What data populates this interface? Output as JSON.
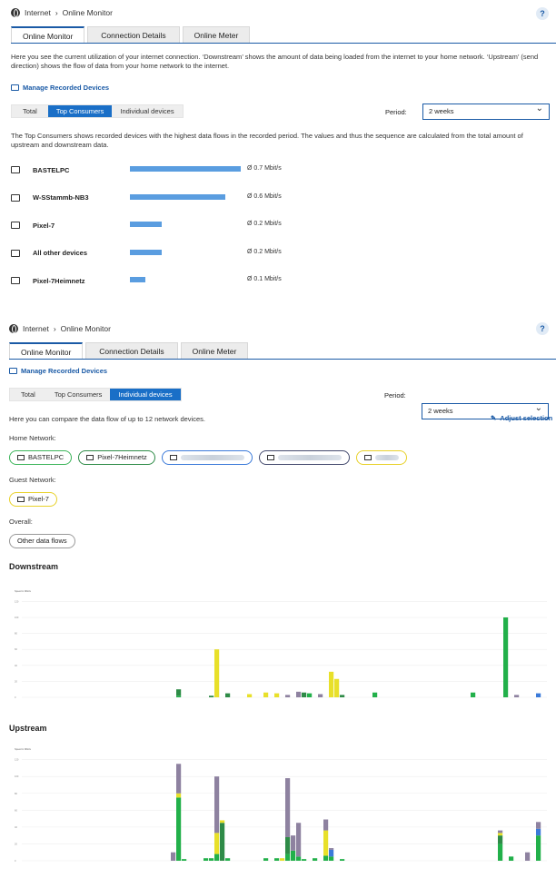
{
  "top": {
    "breadcrumb": [
      "Internet",
      "Online Monitor"
    ],
    "help": "?",
    "tabs": [
      "Online Monitor",
      "Connection Details",
      "Online Meter"
    ],
    "intro": "Here you see the current utilization of your internet connection. ‘Downstream’ shows the amount of data being loaded from the internet to your home network. ‘Upstream’ (send direction) shows the flow of data from your home network to the internet.",
    "manage_link": "Manage Recorded Devices",
    "segments": [
      "Total",
      "Top Consumers",
      "Individual devices"
    ],
    "period_label": "Period:",
    "period_value": "2 weeks",
    "desc": "The Top Consumers shows recorded devices with the highest data flows in the recorded period. The values and thus the sequence are calculated from the total amount of upstream and downstream data.",
    "devices": [
      {
        "name": "BASTELPC",
        "rate": "Ø 0.7 Mbit/s",
        "share": 1.0,
        "icon": "laptop-icon"
      },
      {
        "name": "W-SStammb-NB3",
        "rate": "Ø 0.6 Mbit/s",
        "share": 0.86,
        "icon": "laptop-icon"
      },
      {
        "name": "Pixel-7",
        "rate": "Ø 0.2 Mbit/s",
        "share": 0.29,
        "icon": "phone-icon"
      },
      {
        "name": "All other devices",
        "rate": "Ø 0.2 Mbit/s",
        "share": 0.29,
        "icon": "devices-icon"
      },
      {
        "name": "Pixel-7Heimnetz",
        "rate": "Ø 0.1 Mbit/s",
        "share": 0.14,
        "icon": "phone-laptop-icon"
      }
    ]
  },
  "bottom": {
    "breadcrumb": [
      "Internet",
      "Online Monitor"
    ],
    "help": "?",
    "tabs": [
      "Online Monitor",
      "Connection Details",
      "Online Meter"
    ],
    "manage_link": "Manage Recorded Devices",
    "segments": [
      "Total",
      "Top Consumers",
      "Individual devices"
    ],
    "period_label": "Period:",
    "period_value": "2 weeks",
    "compare_text": "Here you can compare the data flow of up to 12 network devices.",
    "adjust_link": "Adjust selection",
    "home_network_label": "Home Network:",
    "home_chips": [
      {
        "name": "BASTELPC",
        "color": "#3cb55a"
      },
      {
        "name": "Pixel-7Heimnetz",
        "color": "#2e8b47"
      },
      {
        "name": "",
        "color": "#3b7ad9"
      },
      {
        "name": "",
        "color": "#444a6e"
      },
      {
        "name": "",
        "color": "#e8d12a"
      }
    ],
    "guest_network_label": "Guest Network:",
    "guest_chips": [
      {
        "name": "Pixel-7",
        "color": "#e8d12a"
      }
    ],
    "overall_label": "Overall:",
    "overall_chips": [
      {
        "name": "Other data flows",
        "color": "#999999"
      }
    ],
    "downstream_title": "Downstream",
    "upstream_title": "Upstream"
  },
  "chart_data": [
    {
      "type": "bar",
      "title": "Downstream",
      "ylabel": "Speed in Mbit/s",
      "ylim": [
        0,
        125
      ],
      "yticks": [
        0,
        20,
        40,
        60,
        80,
        100,
        120
      ],
      "series_colors": {
        "green": "#22b04a",
        "darkgreen": "#2e8b47",
        "yellow": "#e8e02a",
        "purple": "#8e82a0",
        "blue": "#3b7ad9"
      },
      "bars": [
        {
          "i": 28,
          "green": 2,
          "darkgreen": 8
        },
        {
          "i": 34,
          "darkgreen": 2
        },
        {
          "i": 35,
          "yellow": 60
        },
        {
          "i": 37,
          "darkgreen": 5
        },
        {
          "i": 41,
          "yellow": 4
        },
        {
          "i": 44,
          "yellow": 6
        },
        {
          "i": 46,
          "yellow": 5
        },
        {
          "i": 48,
          "purple": 3
        },
        {
          "i": 50,
          "purple": 7
        },
        {
          "i": 51,
          "darkgreen": 6
        },
        {
          "i": 52,
          "green": 5
        },
        {
          "i": 54,
          "purple": 4
        },
        {
          "i": 56,
          "yellow": 32
        },
        {
          "i": 57,
          "yellow": 23
        },
        {
          "i": 58,
          "darkgreen": 3
        },
        {
          "i": 64,
          "green": 6
        },
        {
          "i": 82,
          "green": 6
        },
        {
          "i": 88,
          "green": 100
        },
        {
          "i": 90,
          "purple": 3
        },
        {
          "i": 94,
          "blue": 5
        }
      ]
    },
    {
      "type": "bar",
      "title": "Upstream",
      "ylabel": "Speed in Mbit/s",
      "ylim": [
        0,
        125
      ],
      "yticks": [
        0,
        20,
        40,
        60,
        80,
        100,
        120
      ],
      "bars": [
        {
          "i": 27,
          "purple": 10
        },
        {
          "i": 28,
          "green": 75,
          "yellow": 5,
          "purple": 35
        },
        {
          "i": 29,
          "green": 2
        },
        {
          "i": 33,
          "green": 3
        },
        {
          "i": 34,
          "green": 3
        },
        {
          "i": 35,
          "green": 8,
          "yellow": 25,
          "purple": 67
        },
        {
          "i": 36,
          "darkgreen": 45,
          "yellow": 3
        },
        {
          "i": 37,
          "green": 3
        },
        {
          "i": 44,
          "green": 3
        },
        {
          "i": 46,
          "green": 3
        },
        {
          "i": 47,
          "yellow": 3
        },
        {
          "i": 48,
          "green": 8,
          "darkgreen": 20,
          "purple": 70
        },
        {
          "i": 49,
          "green": 12,
          "purple": 18
        },
        {
          "i": 50,
          "green": 5,
          "purple": 40
        },
        {
          "i": 51,
          "green": 2
        },
        {
          "i": 53,
          "green": 3
        },
        {
          "i": 55,
          "green": 6,
          "yellow": 30,
          "purple": 13
        },
        {
          "i": 56,
          "green": 5,
          "blue": 8,
          "purple": 2
        },
        {
          "i": 58,
          "green": 2
        },
        {
          "i": 87,
          "green": 20,
          "yellow": 3,
          "purple": 3,
          "darkgreen": 10
        },
        {
          "i": 89,
          "green": 5
        },
        {
          "i": 92,
          "purple": 10
        },
        {
          "i": 94,
          "green": 30,
          "blue": 8,
          "purple": 8
        }
      ]
    }
  ]
}
